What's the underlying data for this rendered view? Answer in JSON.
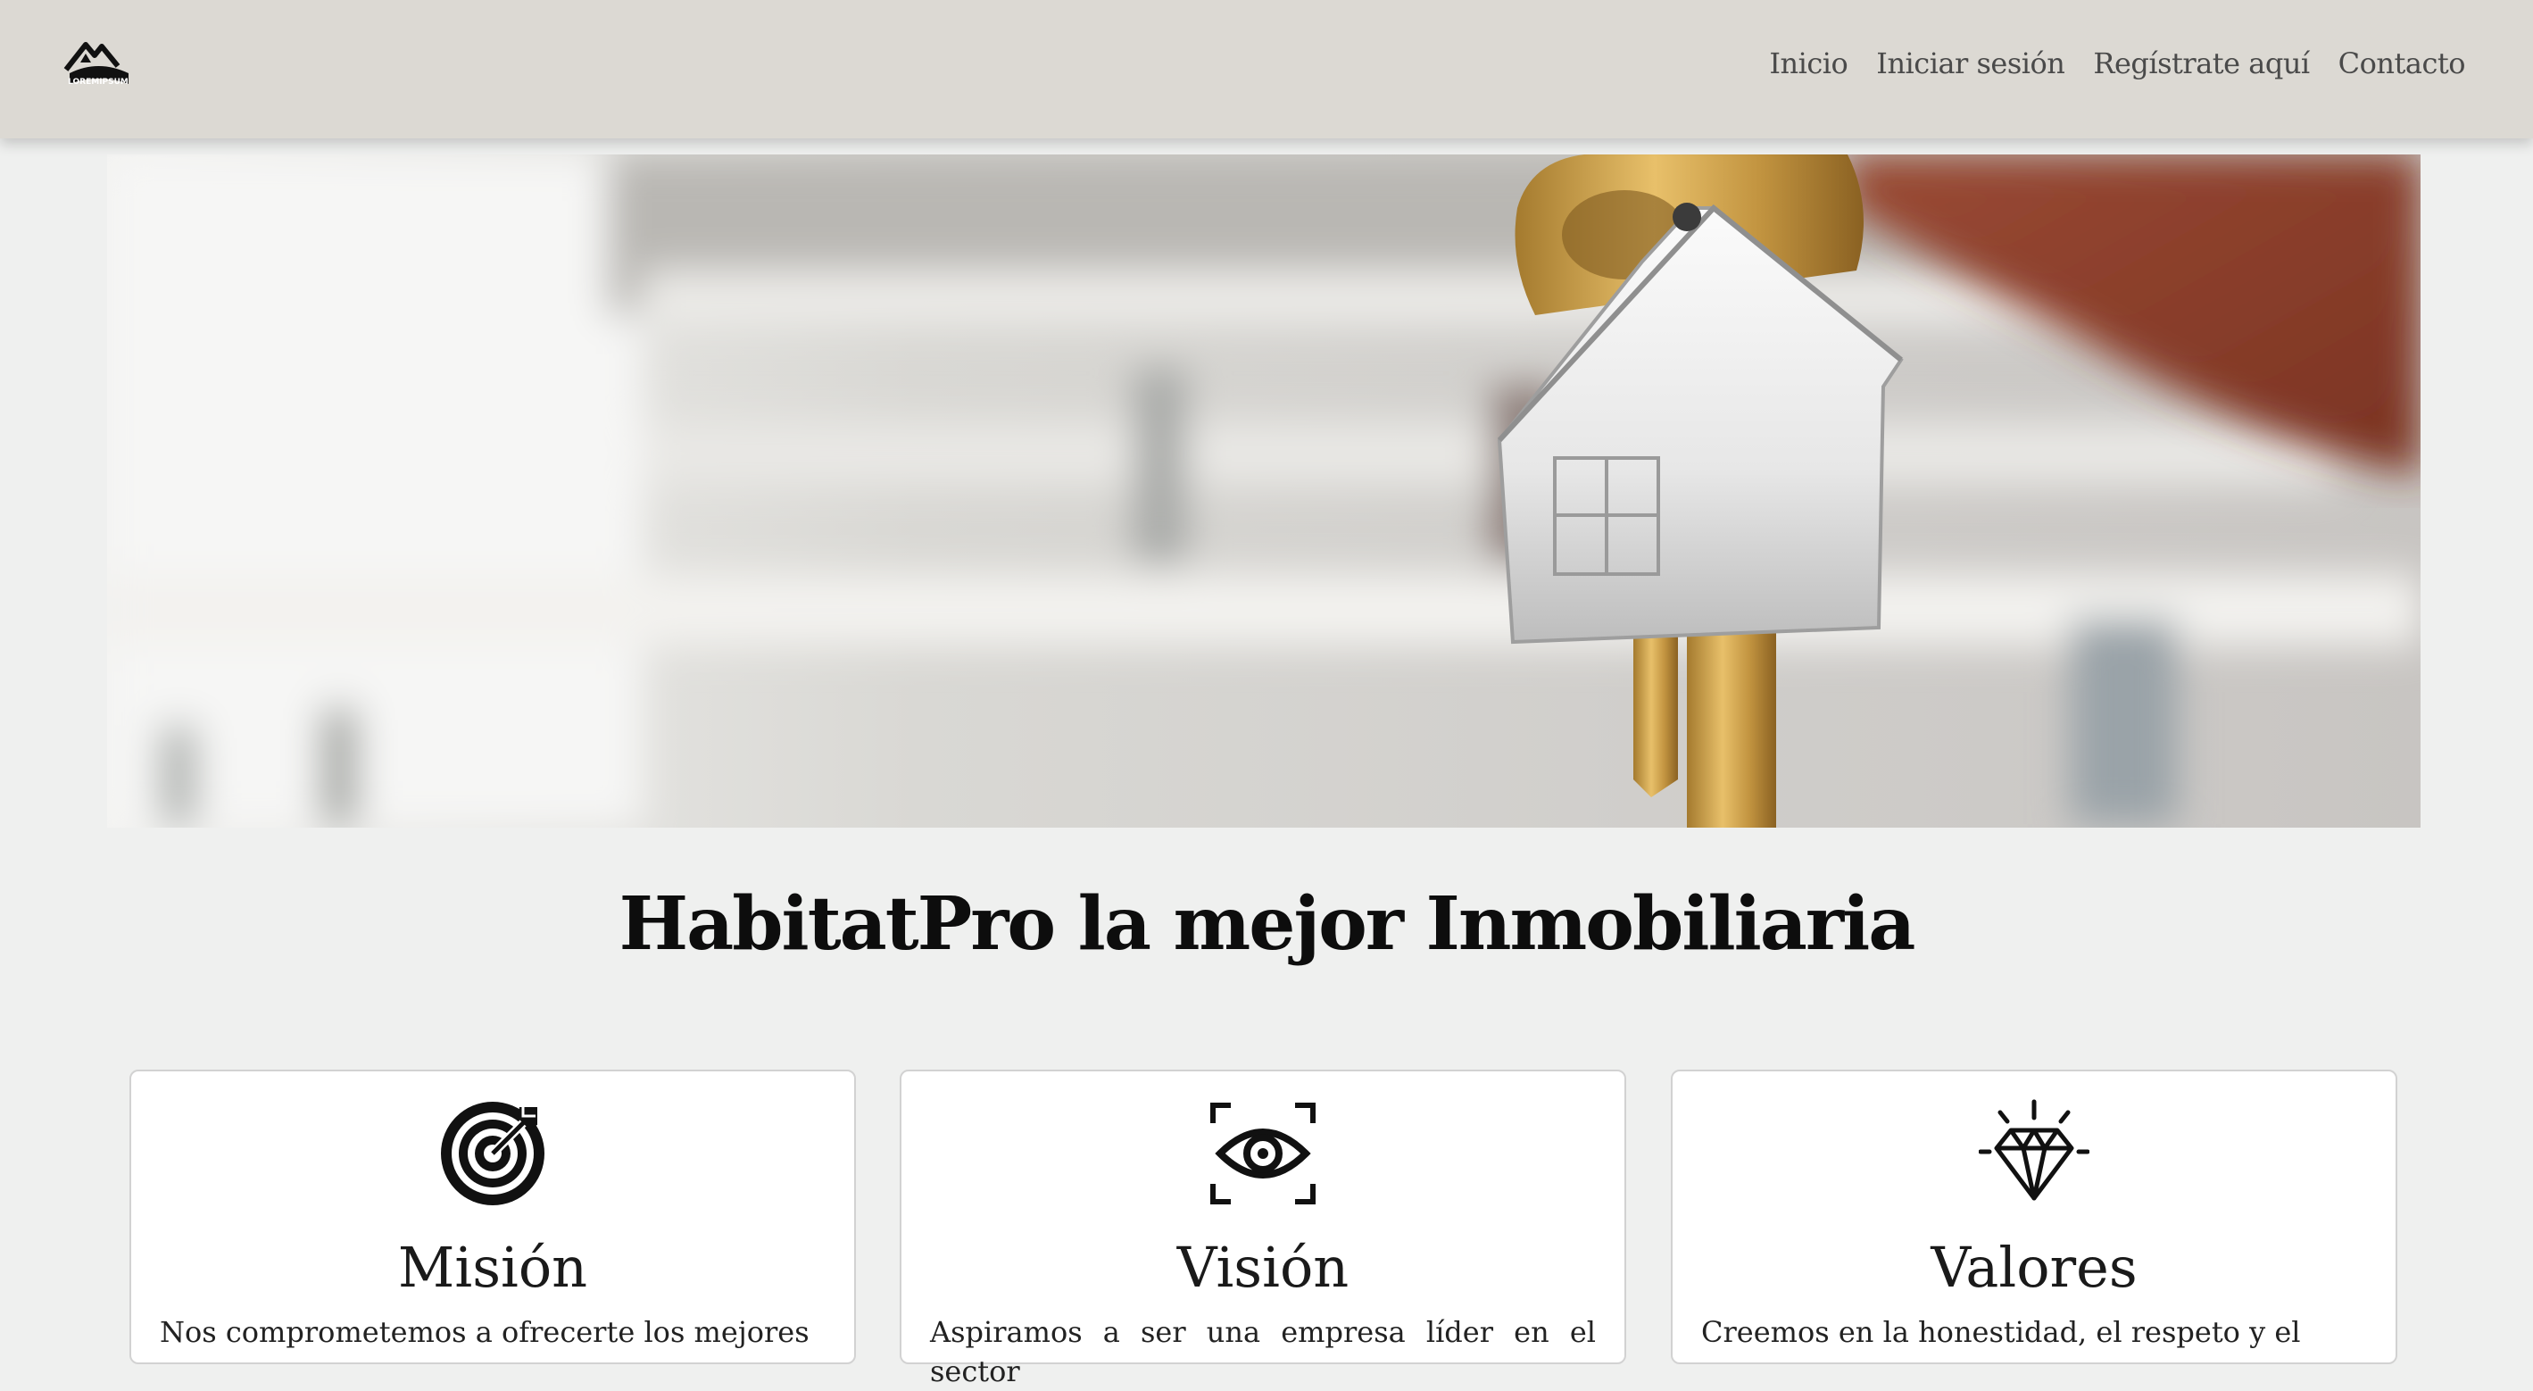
{
  "navbar": {
    "logo_text": "LOREMIPSUM",
    "links": [
      "Inicio",
      "Iniciar sesión",
      "Regístrate aquí",
      "Contacto"
    ]
  },
  "hero": {
    "image": "house-key-keychain-photo"
  },
  "page_title": "HabitatPro la mejor Inmobiliaria",
  "cards": [
    {
      "icon": "target-icon",
      "title": "Misión",
      "text": "Nos comprometemos a ofrecerte los mejores"
    },
    {
      "icon": "eye-icon",
      "title": "Visión",
      "text": "Aspiramos a ser una empresa líder en el sector"
    },
    {
      "icon": "diamond-icon",
      "title": "Valores",
      "text": "Creemos en la honestidad, el respeto y el"
    }
  ],
  "colors": {
    "navbar_bg": "#dcd9d3",
    "page_bg": "#eff0ef",
    "card_bg": "#ffffff",
    "text": "#111111"
  }
}
